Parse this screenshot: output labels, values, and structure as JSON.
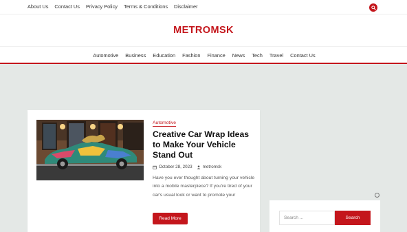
{
  "topbar": {
    "links": [
      "About Us",
      "Contact Us",
      "Privacy Policy",
      "Terms & Conditions",
      "Disclaimer"
    ],
    "search_icon": "search-icon"
  },
  "header": {
    "site_title": "METROMSK",
    "nav": [
      "Automotive",
      "Business",
      "Education",
      "Fashion",
      "Finance",
      "News",
      "Tech",
      "Travel",
      "Contact Us"
    ]
  },
  "post": {
    "category": "Automotive",
    "title": "Creative Car Wrap Ideas to Make Your Vehicle Stand Out",
    "date": "October 28, 2023",
    "author": "metromsk",
    "excerpt": "Have you ever thought about turning your vehicle into a mobile masterpiece? If you're tired of your car's usual look or want to promote your",
    "read_more": "Read More",
    "image_icon": "car-photo"
  },
  "sidebar": {
    "search_placeholder": "Search ...",
    "search_button": "Search"
  },
  "colors": {
    "accent": "#c4161c",
    "background": "#e4e8e6"
  }
}
